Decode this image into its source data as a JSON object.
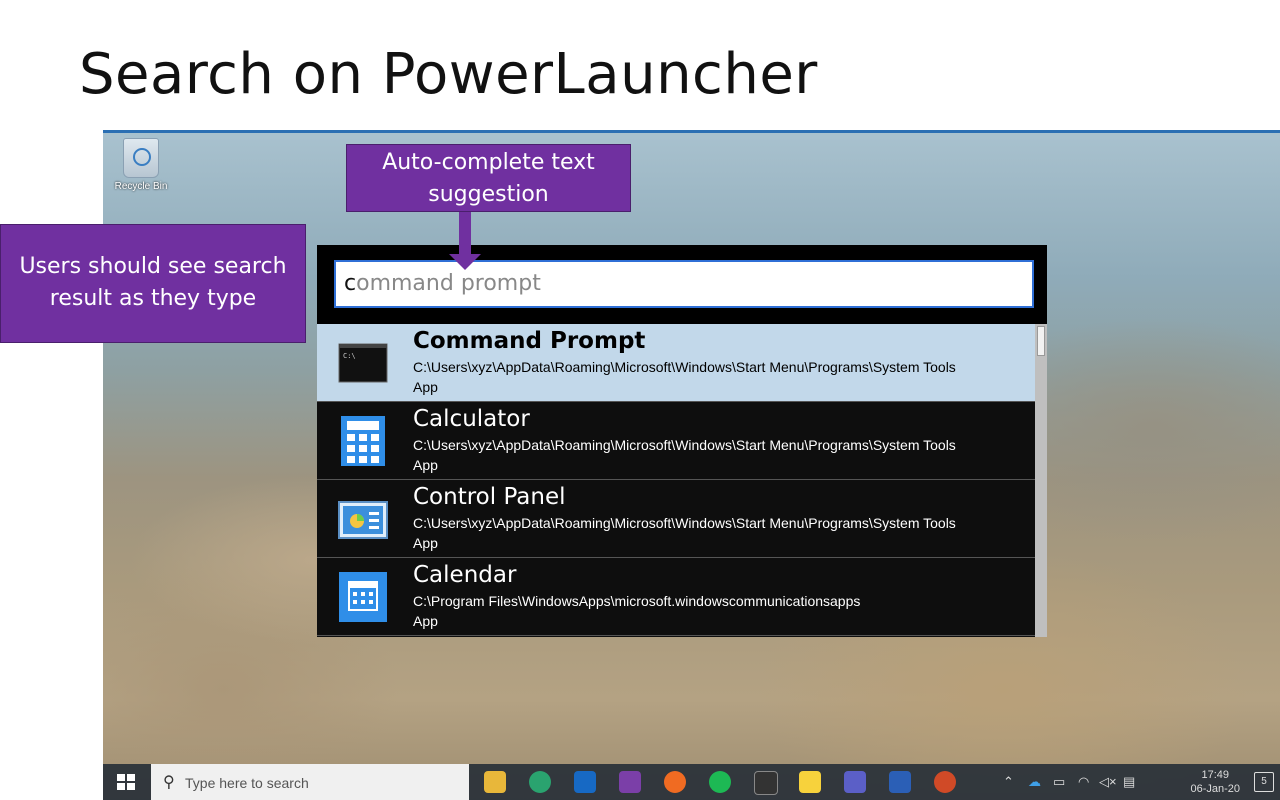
{
  "slide": {
    "title": "Search on PowerLauncher"
  },
  "desktop": {
    "recycle_bin_label": "Recycle Bin"
  },
  "callouts": {
    "left": {
      "line1": "Users should see search",
      "line2": "result as they type"
    },
    "top": {
      "line1": "Auto-complete text",
      "line2": "suggestion"
    }
  },
  "search": {
    "typed": "c",
    "suggestion": "ommand prompt"
  },
  "results": [
    {
      "name": "Command Prompt",
      "path": "C:\\Users\\xyz\\AppData\\Roaming\\Microsoft\\Windows\\Start Menu\\Programs\\System Tools",
      "kind": "App",
      "icon": "terminal-icon",
      "selected": true
    },
    {
      "name": "Calculator",
      "path": "C:\\Users\\xyz\\AppData\\Roaming\\Microsoft\\Windows\\Start Menu\\Programs\\System Tools",
      "kind": "App",
      "icon": "calculator-icon",
      "selected": false
    },
    {
      "name": "Control Panel",
      "path": "C:\\Users\\xyz\\AppData\\Roaming\\Microsoft\\Windows\\Start Menu\\Programs\\System Tools",
      "kind": "App",
      "icon": "control-panel-icon",
      "selected": false
    },
    {
      "name": "Calendar",
      "path": "C:\\Program Files\\WindowsApps\\microsoft.windowscommunicationsapps",
      "kind": "App",
      "icon": "calendar-icon",
      "selected": false
    }
  ],
  "taskbar": {
    "search_placeholder": "Type here to search",
    "time": "17:49",
    "date": "06-Jan-20",
    "notification_count": "5",
    "apps": [
      "file-explorer-icon",
      "edge-icon",
      "outlook-icon",
      "onenote-icon",
      "firefox-icon",
      "spotify-icon",
      "terminal-icon",
      "sticky-notes-icon",
      "teams-icon",
      "word-icon",
      "powerpoint-icon"
    ]
  },
  "colors": {
    "callout": "#7030a0",
    "selected_row": "#c2d8ea",
    "search_border": "#2f6fd6"
  }
}
